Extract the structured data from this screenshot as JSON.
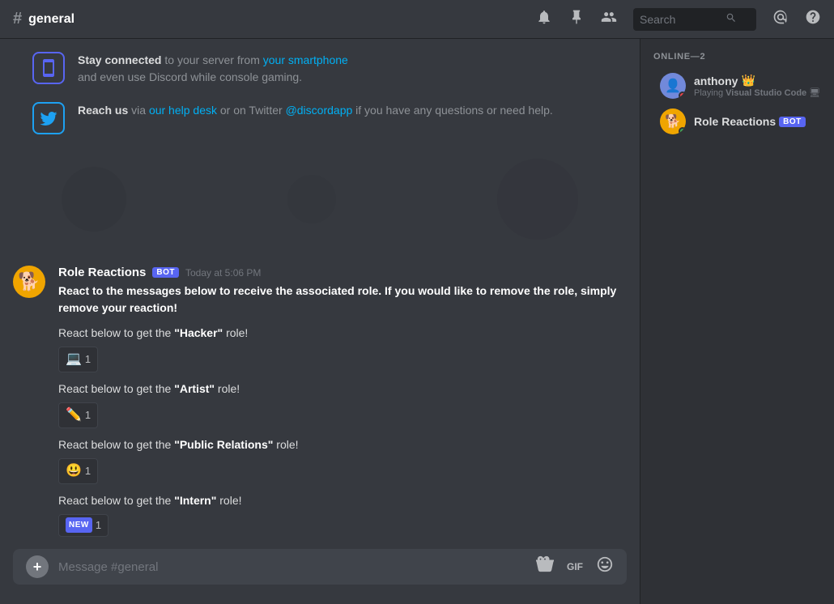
{
  "topbar": {
    "hash": "#",
    "channel_name": "general",
    "search_placeholder": "Search"
  },
  "system_messages": [
    {
      "id": "phone",
      "icon": "📱",
      "icon_type": "phone",
      "text_before": "Stay connected",
      "text_before_bold": true,
      "text_middle": " to your server from ",
      "link_text": "your smartphone",
      "link_url": "#",
      "text_after": " and even use Discord while console gaming."
    },
    {
      "id": "twitter",
      "icon": "🐦",
      "icon_type": "twitter",
      "text_before": "Reach us",
      "text_before_bold": true,
      "text_middle": " via ",
      "link1_text": "our help desk",
      "link1_url": "#",
      "text_middle2": " or on Twitter ",
      "link2_text": "@discordapp",
      "link2_url": "#",
      "text_after": " if you have any questions or need help."
    }
  ],
  "bot_message": {
    "author": "Role Reactions",
    "is_bot": true,
    "bot_badge": "BOT",
    "timestamp": "Today at 5:06 PM",
    "avatar_emoji": "🐕",
    "intro_bold": "React to the messages below to receive the associated role. If you would like to remove the role, simply remove your reaction!",
    "roles": [
      {
        "id": "hacker",
        "text_before": "React below to get the ",
        "role_name": "\"Hacker\"",
        "text_after": " role!",
        "emoji": "💻",
        "count": "1"
      },
      {
        "id": "artist",
        "text_before": "React below to get the ",
        "role_name": "\"Artist\"",
        "text_after": " role!",
        "emoji": "✏️",
        "count": "1"
      },
      {
        "id": "pr",
        "text_before": "React below to get the ",
        "role_name": "\"Public Relations\"",
        "text_after": " role!",
        "emoji": "😃",
        "count": "1"
      },
      {
        "id": "intern",
        "text_before": "React below to get the ",
        "role_name": "\"Intern\"",
        "text_after": " role!",
        "emoji": "NEW",
        "count": "1",
        "is_new_badge": true
      }
    ]
  },
  "message_input": {
    "placeholder": "Message #general"
  },
  "sidebar": {
    "section_title": "ONLINE—2",
    "members": [
      {
        "id": "anthony",
        "name": "anthony",
        "has_crown": true,
        "crown_emoji": "👑",
        "status": "dnd",
        "activity": "Playing Visual Studio Code",
        "avatar_emoji": "👤",
        "avatar_color": "#7289da"
      },
      {
        "id": "role-reactions",
        "name": "Role Reactions",
        "is_bot": true,
        "bot_badge": "BOT",
        "status": "online",
        "avatar_emoji": "🐕",
        "avatar_color": "#f0a500"
      }
    ]
  },
  "icons": {
    "bell": "🔔",
    "pin": "📌",
    "members": "👤",
    "search": "🔍",
    "at": "@",
    "help": "?",
    "plus": "+",
    "gift": "🎁",
    "gif": "GIF",
    "emoji": "🙂"
  }
}
